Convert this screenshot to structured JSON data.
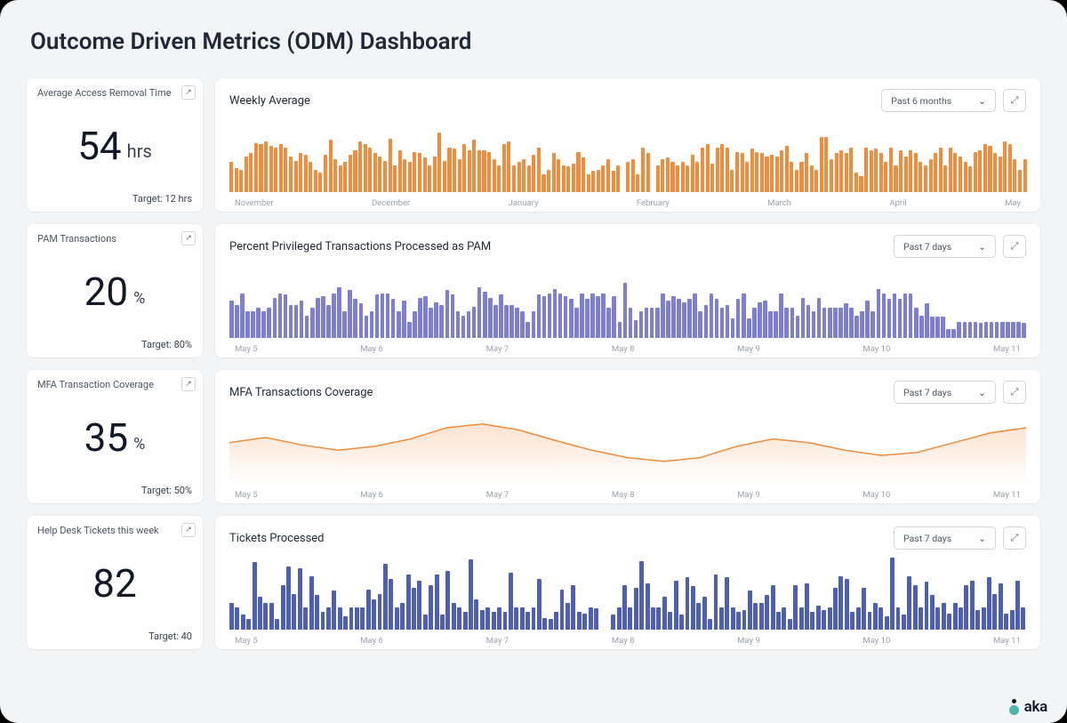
{
  "title": "Outcome Driven Metrics (ODM) Dashboard",
  "logo_text": "aka",
  "rows": [
    {
      "kpi": {
        "title": "Average Access Removal Time",
        "value": "54",
        "unit": "hrs",
        "target": "Target: 12 hrs"
      },
      "chart": {
        "title": "Weekly Average",
        "range": "Past 6 months"
      }
    },
    {
      "kpi": {
        "title": "PAM Transactions",
        "value": "20",
        "unit": "%",
        "target": "Target: 80%"
      },
      "chart": {
        "title": "Percent Privileged Transactions Processed as PAM",
        "range": "Past 7 days"
      }
    },
    {
      "kpi": {
        "title": "MFA Transaction Coverage",
        "value": "35",
        "unit": "%",
        "target": "Target: 50%"
      },
      "chart": {
        "title": "MFA Transactions Coverage",
        "range": "Past 7 days"
      }
    },
    {
      "kpi": {
        "title": "Help Desk Tickets this week",
        "value": "82",
        "unit": "",
        "target": "Target: 40"
      },
      "chart": {
        "title": "Tickets Processed",
        "range": "Past 7 days"
      }
    }
  ],
  "chart_data": [
    {
      "type": "bar",
      "title": "Weekly Average",
      "color": "#F08C3C",
      "categories": [
        "November",
        "December",
        "January",
        "February",
        "March",
        "April",
        "May"
      ],
      "ylim": [
        0,
        100
      ],
      "values": [
        40,
        32,
        30,
        48,
        52,
        66,
        64,
        68,
        62,
        60,
        64,
        60,
        48,
        42,
        52,
        50,
        40,
        30,
        26,
        50,
        70,
        44,
        36,
        40,
        50,
        56,
        68,
        64,
        60,
        52,
        48,
        42,
        72,
        36,
        56,
        44,
        40,
        54,
        52,
        46,
        36,
        48,
        80,
        42,
        60,
        58,
        44,
        64,
        56,
        70,
        56,
        56,
        54,
        44,
        36,
        64,
        68,
        36,
        40,
        44,
        36,
        50,
        60,
        24,
        30,
        52,
        44,
        36,
        34,
        38,
        54,
        46,
        24,
        28,
        30,
        36,
        44,
        28,
        36,
        0,
        40,
        44,
        24,
        60,
        52,
        0,
        36,
        44,
        46,
        40,
        36,
        40,
        36,
        50,
        40,
        60,
        64,
        38,
        60,
        64,
        60,
        30,
        54,
        52,
        40,
        58,
        54,
        52,
        48,
        50,
        48,
        56,
        62,
        40,
        30,
        40,
        52,
        36,
        30,
        74,
        74,
        44,
        52,
        56,
        52,
        60,
        26,
        22,
        60,
        56,
        58,
        52,
        40,
        60,
        36,
        56,
        48,
        56,
        52,
        40,
        36,
        44,
        52,
        60,
        36,
        60,
        52,
        48,
        40,
        34,
        54,
        56,
        64,
        62,
        52,
        48,
        68,
        64,
        44,
        30,
        44
      ]
    },
    {
      "type": "bar",
      "title": "Percent Privileged Transactions Processed as PAM",
      "color": "#7C7FD4",
      "categories": [
        "May 5",
        "May 6",
        "May 7",
        "May 8",
        "May 9",
        "May 10",
        "May 11"
      ],
      "ylim": [
        0,
        100
      ],
      "values": [
        50,
        44,
        60,
        36,
        36,
        40,
        36,
        40,
        54,
        60,
        58,
        44,
        44,
        50,
        30,
        40,
        54,
        56,
        44,
        60,
        68,
        36,
        64,
        52,
        46,
        30,
        36,
        58,
        60,
        60,
        52,
        36,
        50,
        22,
        36,
        54,
        56,
        40,
        48,
        44,
        64,
        58,
        36,
        30,
        36,
        42,
        68,
        62,
        54,
        44,
        58,
        44,
        44,
        40,
        36,
        22,
        36,
        58,
        56,
        60,
        66,
        60,
        56,
        52,
        40,
        60,
        52,
        60,
        56,
        60,
        40,
        56,
        22,
        74,
        40,
        24,
        36,
        40,
        40,
        40,
        60,
        50,
        56,
        52,
        48,
        52,
        60,
        36,
        44,
        60,
        52,
        40,
        44,
        26,
        52,
        60,
        26,
        40,
        48,
        50,
        36,
        36,
        60,
        40,
        40,
        30,
        54,
        44,
        36,
        54,
        40,
        40,
        40,
        40,
        46,
        40,
        30,
        36,
        50,
        36,
        66,
        60,
        52,
        60,
        52,
        60,
        60,
        40,
        30,
        46,
        28,
        28,
        28,
        12,
        12,
        22,
        22,
        22,
        22,
        20,
        22,
        22,
        22,
        22,
        22,
        22,
        22,
        20
      ]
    },
    {
      "type": "area",
      "title": "MFA Transactions Coverage",
      "color": "#F08C3C",
      "x": [
        "May 5",
        "May 6",
        "May 7",
        "May 8",
        "May 9",
        "May 10",
        "May 11"
      ],
      "ylim": [
        0,
        100
      ],
      "values": [
        55,
        62,
        52,
        45,
        50,
        60,
        75,
        80,
        72,
        58,
        45,
        35,
        30,
        35,
        50,
        60,
        55,
        45,
        38,
        42,
        55,
        68,
        75
      ]
    },
    {
      "type": "bar",
      "title": "Tickets Processed",
      "color": "#4C5FB5",
      "categories": [
        "May 5",
        "May 6",
        "May 7",
        "May 8",
        "May 9",
        "May 10",
        "May 11"
      ],
      "ylim": [
        0,
        100
      ],
      "values": [
        36,
        30,
        20,
        14,
        90,
        44,
        36,
        36,
        14,
        60,
        84,
        48,
        82,
        30,
        72,
        46,
        24,
        30,
        52,
        30,
        18,
        30,
        30,
        30,
        54,
        40,
        48,
        88,
        68,
        30,
        36,
        74,
        56,
        66,
        20,
        60,
        74,
        20,
        78,
        36,
        30,
        24,
        94,
        40,
        26,
        30,
        24,
        30,
        24,
        76,
        30,
        30,
        24,
        30,
        68,
        16,
        14,
        24,
        54,
        36,
        60,
        24,
        22,
        30,
        28,
        0,
        0,
        20,
        30,
        60,
        30,
        56,
        92,
        62,
        30,
        30,
        44,
        24,
        66,
        20,
        70,
        58,
        36,
        44,
        14,
        74,
        30,
        70,
        30,
        24,
        26,
        52,
        36,
        36,
        46,
        60,
        24,
        30,
        14,
        60,
        30,
        62,
        24,
        32,
        26,
        30,
        56,
        72,
        68,
        24,
        30,
        56,
        24,
        36,
        30,
        18,
        96,
        30,
        20,
        72,
        60,
        30,
        64,
        46,
        30,
        36,
        22,
        36,
        30,
        60,
        66,
        26,
        30,
        70,
        48,
        62,
        22,
        26,
        66,
        30
      ]
    }
  ]
}
